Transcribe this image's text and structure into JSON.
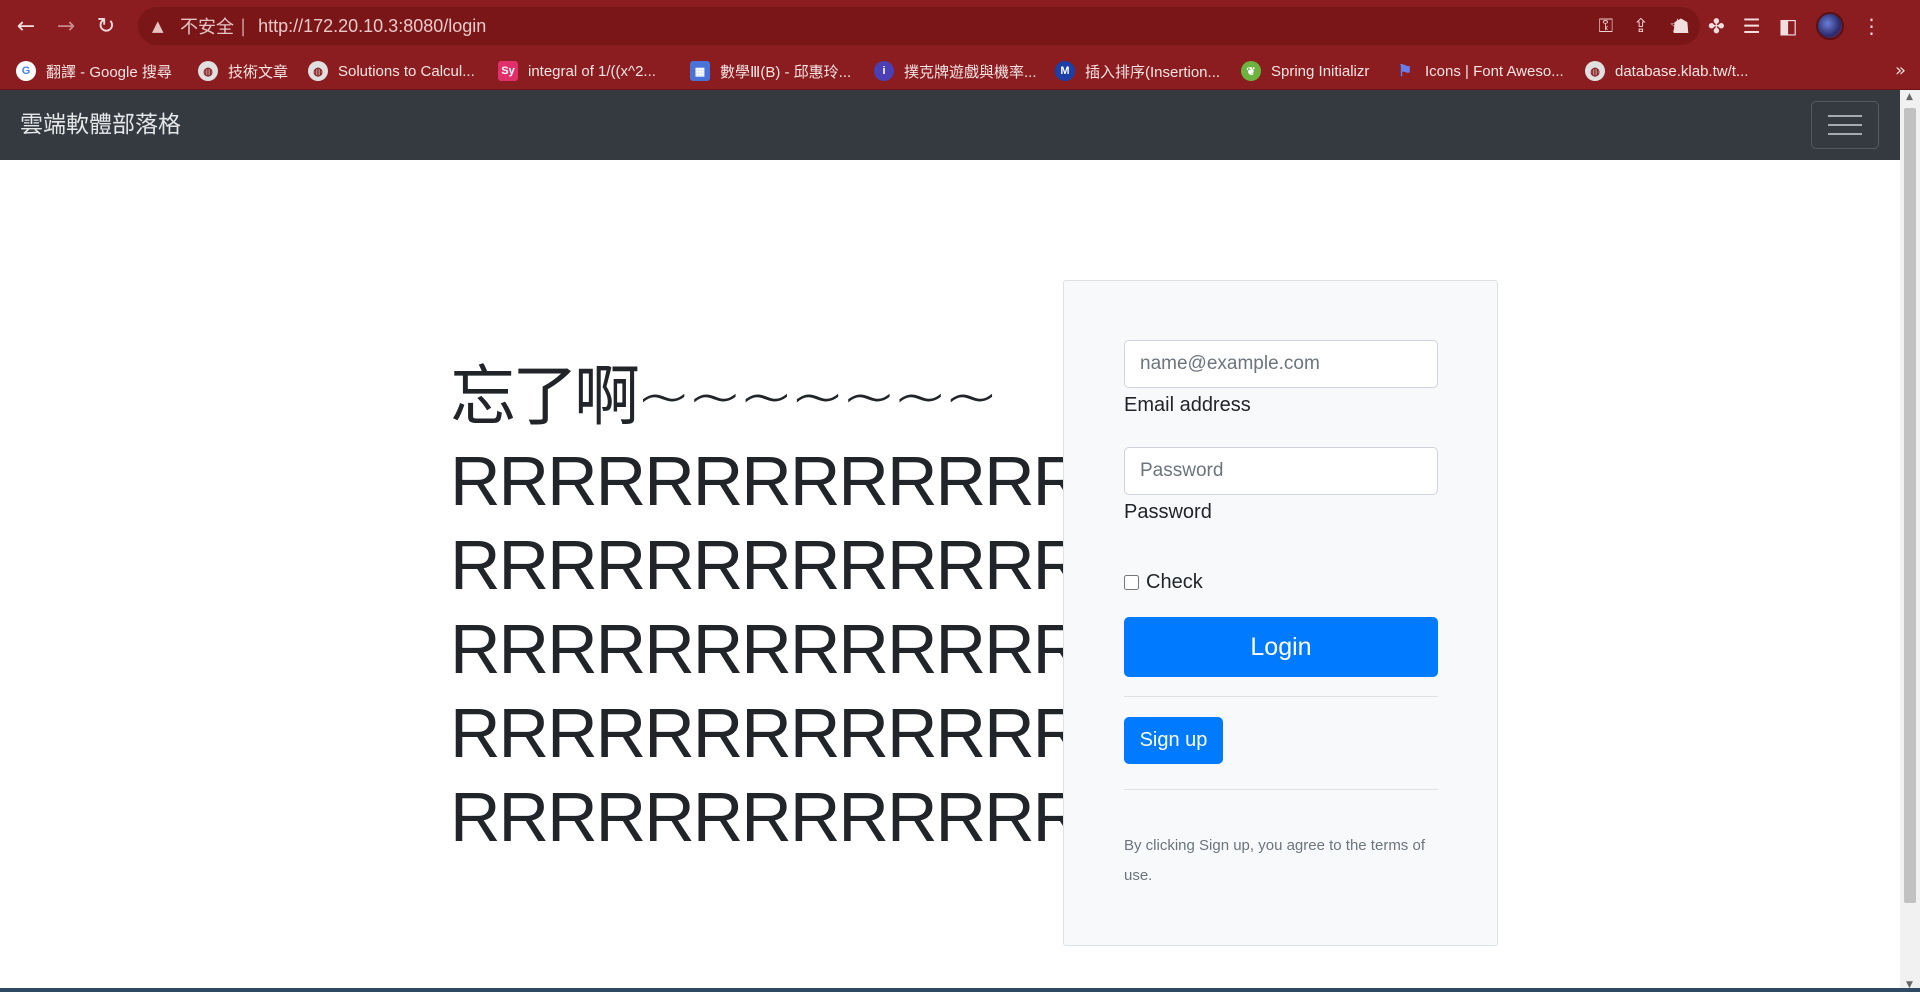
{
  "browser": {
    "insecure_label": "不安全",
    "separator": "|",
    "url": "http://172.20.10.3:8080/login",
    "bookmarks": [
      {
        "label": "翻譯 - Google 搜尋",
        "icon": "google-icon",
        "color": "#ffffff"
      },
      {
        "label": "技術文章",
        "icon": "globe-icon",
        "color": "#e0e0e0"
      },
      {
        "label": "Solutions to Calcul...",
        "icon": "globe-icon",
        "color": "#e0e0e0"
      },
      {
        "label": "integral of 1/((x^2...",
        "icon": "symbolab-icon",
        "color": "#e0306b"
      },
      {
        "label": "數學Ⅲ(B) - 邱惠玲...",
        "icon": "calendar-icon",
        "color": "#4a73d9"
      },
      {
        "label": "撲克牌遊戲與機率...",
        "icon": "info-icon",
        "color": "#4b3fb5"
      },
      {
        "label": "插入排序(Insertion...",
        "icon": "medium-icon",
        "color": "#1c3fa8"
      },
      {
        "label": "Spring Initializr",
        "icon": "spring-icon",
        "color": "#6db33f"
      },
      {
        "label": "Icons | Font Aweso...",
        "icon": "flag-icon",
        "color": "#6b7de8"
      },
      {
        "label": "database.klab.tw/t...",
        "icon": "globe-icon",
        "color": "#e0e0e0"
      }
    ],
    "more_label": "»"
  },
  "site": {
    "brand": "雲端軟體部落格"
  },
  "hero": {
    "lines": [
      "忘了啊~~~~~~~",
      "RRRRRRRRRRRRR",
      "RRRRRRRRRRRRR",
      "RRRRRRRRRRRRR",
      "RRRRRRRRRRRRR",
      "RRRRRRRRRRRRR"
    ]
  },
  "login_form": {
    "email_placeholder": "name@example.com",
    "email_label": "Email address",
    "password_placeholder": "Password",
    "password_label": "Password",
    "check_label": "Check",
    "login_button": "Login",
    "signup_button": "Sign up",
    "terms_text": "By clicking Sign up, you agree to the terms of use."
  },
  "colors": {
    "chrome": "#8b1c1f",
    "navbar": "#343a40",
    "primary": "#007bff"
  }
}
